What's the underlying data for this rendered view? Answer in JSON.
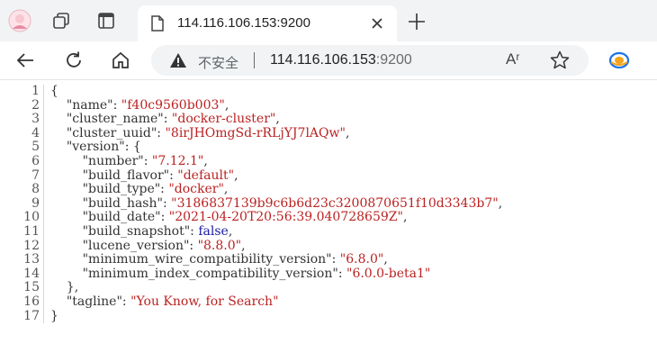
{
  "tab": {
    "title": "114.116.106.153:9200"
  },
  "address": {
    "security_label": "不安全",
    "url_host": "114.116.106.153",
    "url_port": ":9200",
    "reader_label": "Aʳ"
  },
  "json_view": {
    "lines": [
      [
        {
          "t": "p",
          "v": "{"
        }
      ],
      [
        {
          "t": "p",
          "v": "    "
        },
        {
          "t": "k",
          "v": "\"name\""
        },
        {
          "t": "p",
          "v": ": "
        },
        {
          "t": "s",
          "v": "\"f40c9560b003\""
        },
        {
          "t": "p",
          "v": ","
        }
      ],
      [
        {
          "t": "p",
          "v": "    "
        },
        {
          "t": "k",
          "v": "\"cluster_name\""
        },
        {
          "t": "p",
          "v": ": "
        },
        {
          "t": "s",
          "v": "\"docker-cluster\""
        },
        {
          "t": "p",
          "v": ","
        }
      ],
      [
        {
          "t": "p",
          "v": "    "
        },
        {
          "t": "k",
          "v": "\"cluster_uuid\""
        },
        {
          "t": "p",
          "v": ": "
        },
        {
          "t": "s",
          "v": "\"8irJHOmgSd-rRLjYJ7lAQw\""
        },
        {
          "t": "p",
          "v": ","
        }
      ],
      [
        {
          "t": "p",
          "v": "    "
        },
        {
          "t": "k",
          "v": "\"version\""
        },
        {
          "t": "p",
          "v": ": {"
        }
      ],
      [
        {
          "t": "p",
          "v": "        "
        },
        {
          "t": "k",
          "v": "\"number\""
        },
        {
          "t": "p",
          "v": ": "
        },
        {
          "t": "s",
          "v": "\"7.12.1\""
        },
        {
          "t": "p",
          "v": ","
        }
      ],
      [
        {
          "t": "p",
          "v": "        "
        },
        {
          "t": "k",
          "v": "\"build_flavor\""
        },
        {
          "t": "p",
          "v": ": "
        },
        {
          "t": "s",
          "v": "\"default\""
        },
        {
          "t": "p",
          "v": ","
        }
      ],
      [
        {
          "t": "p",
          "v": "        "
        },
        {
          "t": "k",
          "v": "\"build_type\""
        },
        {
          "t": "p",
          "v": ": "
        },
        {
          "t": "s",
          "v": "\"docker\""
        },
        {
          "t": "p",
          "v": ","
        }
      ],
      [
        {
          "t": "p",
          "v": "        "
        },
        {
          "t": "k",
          "v": "\"build_hash\""
        },
        {
          "t": "p",
          "v": ": "
        },
        {
          "t": "s",
          "v": "\"3186837139b9c6b6d23c3200870651f10d3343b7\""
        },
        {
          "t": "p",
          "v": ","
        }
      ],
      [
        {
          "t": "p",
          "v": "        "
        },
        {
          "t": "k",
          "v": "\"build_date\""
        },
        {
          "t": "p",
          "v": ": "
        },
        {
          "t": "s",
          "v": "\"2021-04-20T20:56:39.040728659Z\""
        },
        {
          "t": "p",
          "v": ","
        }
      ],
      [
        {
          "t": "p",
          "v": "        "
        },
        {
          "t": "k",
          "v": "\"build_snapshot\""
        },
        {
          "t": "p",
          "v": ": "
        },
        {
          "t": "b",
          "v": "false"
        },
        {
          "t": "p",
          "v": ","
        }
      ],
      [
        {
          "t": "p",
          "v": "        "
        },
        {
          "t": "k",
          "v": "\"lucene_version\""
        },
        {
          "t": "p",
          "v": ": "
        },
        {
          "t": "s",
          "v": "\"8.8.0\""
        },
        {
          "t": "p",
          "v": ","
        }
      ],
      [
        {
          "t": "p",
          "v": "        "
        },
        {
          "t": "k",
          "v": "\"minimum_wire_compatibility_version\""
        },
        {
          "t": "p",
          "v": ": "
        },
        {
          "t": "s",
          "v": "\"6.8.0\""
        },
        {
          "t": "p",
          "v": ","
        }
      ],
      [
        {
          "t": "p",
          "v": "        "
        },
        {
          "t": "k",
          "v": "\"minimum_index_compatibility_version\""
        },
        {
          "t": "p",
          "v": ": "
        },
        {
          "t": "s",
          "v": "\"6.0.0-beta1\""
        }
      ],
      [
        {
          "t": "p",
          "v": "    },"
        }
      ],
      [
        {
          "t": "p",
          "v": "    "
        },
        {
          "t": "k",
          "v": "\"tagline\""
        },
        {
          "t": "p",
          "v": ": "
        },
        {
          "t": "s",
          "v": "\"You Know, for Search\""
        }
      ],
      [
        {
          "t": "p",
          "v": "}"
        }
      ]
    ]
  },
  "colors": {
    "key": "#333333",
    "string": "#bb2222",
    "boolean": "#1a1aa6"
  },
  "icons": [
    "profile-icon",
    "workspaces-icon",
    "vertical-tabs-icon",
    "page-icon",
    "close-icon",
    "new-tab-icon",
    "back-icon",
    "refresh-icon",
    "home-icon",
    "warning-icon",
    "read-aloud-icon",
    "favorite-star-icon",
    "extension-icon"
  ]
}
